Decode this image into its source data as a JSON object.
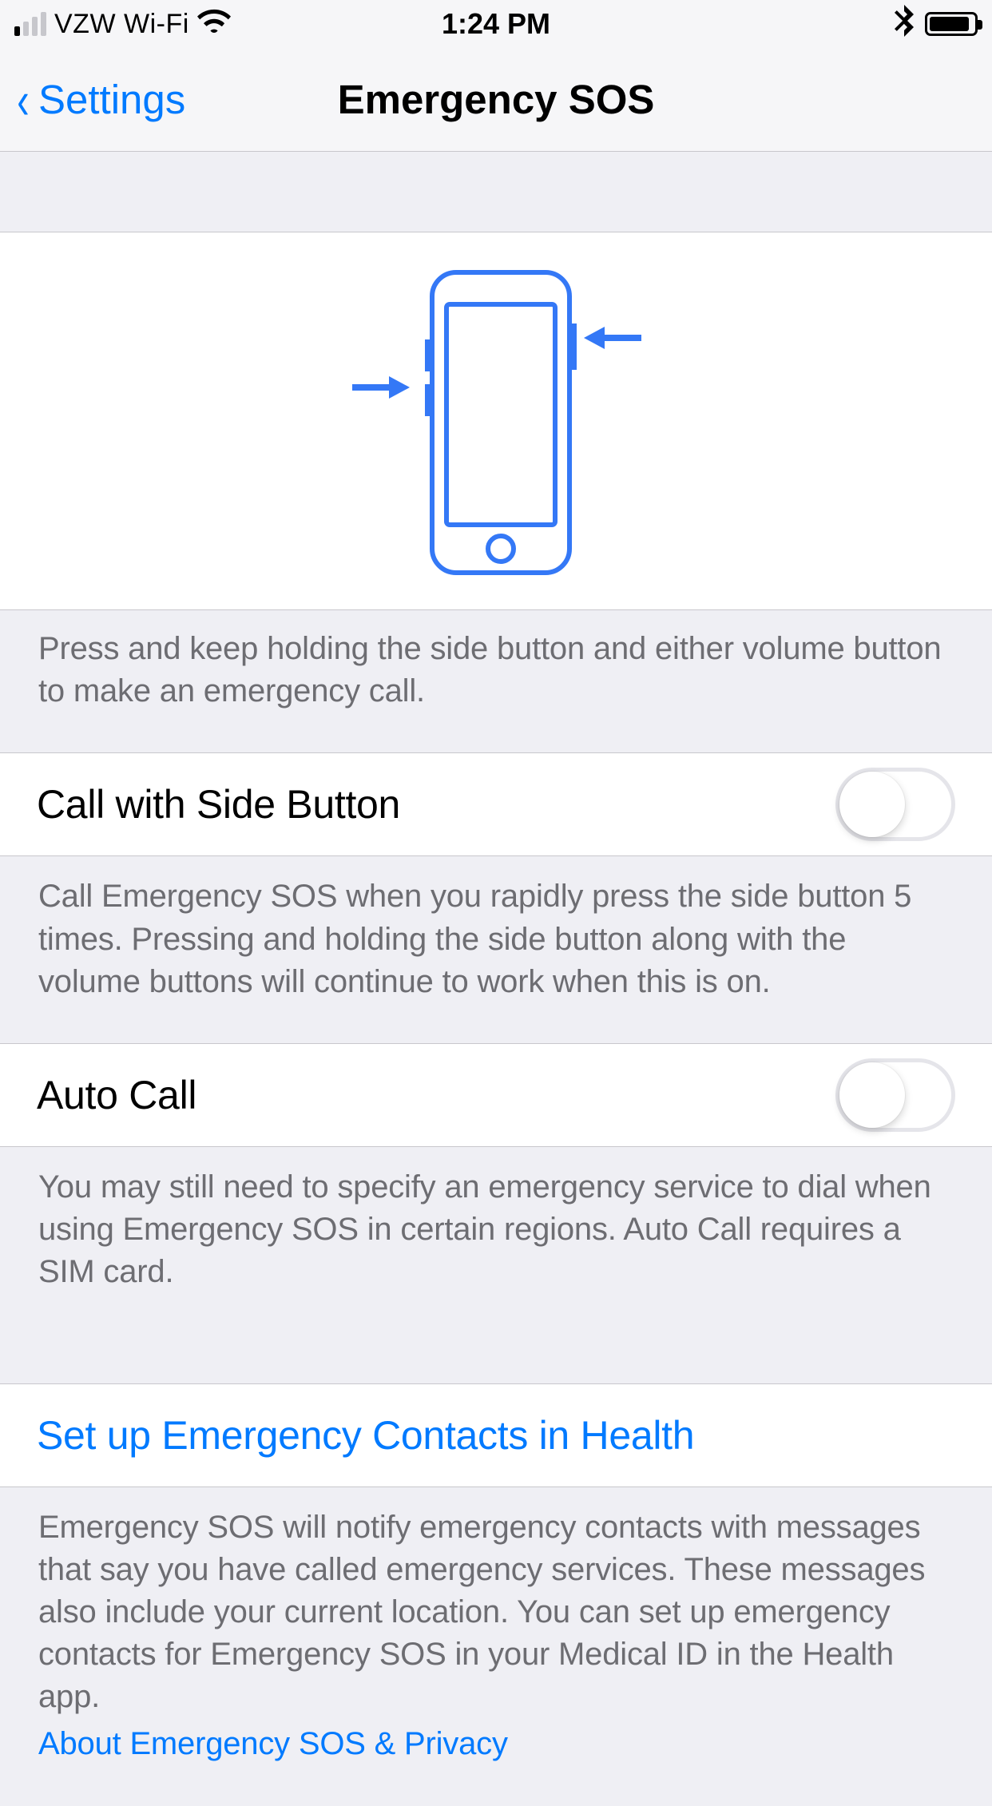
{
  "status_bar": {
    "carrier": "VZW Wi-Fi",
    "time": "1:24 PM"
  },
  "nav": {
    "back_label": "Settings",
    "title": "Emergency SOS"
  },
  "illustration_footer": "Press and keep holding the side button and either volume button to make an emergency call.",
  "rows": {
    "call_side_button": {
      "label": "Call with Side Button",
      "on": false,
      "footer": "Call Emergency SOS when you rapidly press the side button 5 times. Pressing and holding the side button along with the volume buttons will continue to work when this is on."
    },
    "auto_call": {
      "label": "Auto Call",
      "on": false,
      "footer": "You may still need to specify an emergency service to dial when using Emergency SOS in certain regions. Auto Call requires a SIM card."
    },
    "setup_contacts": {
      "label": "Set up Emergency Contacts in Health",
      "footer": "Emergency SOS will notify emergency contacts with messages that say you have called emergency services. These messages also include your current location. You can set up emergency contacts for Emergency SOS in your Medical ID in the Health app.",
      "privacy_link": "About Emergency SOS & Privacy"
    }
  }
}
